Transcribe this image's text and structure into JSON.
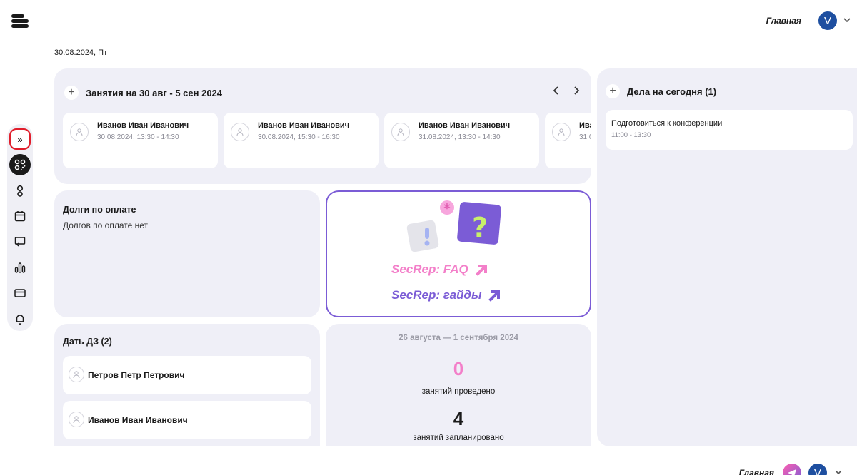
{
  "header": {
    "nav_title": "Главная",
    "avatar_letter": "V"
  },
  "date_line": "30.08.2024, Пт",
  "sidebar": {
    "expand_label": "»"
  },
  "lessons": {
    "title": "Занятия на 30 авг - 5 сен 2024",
    "cards": [
      {
        "name": "Иванов Иван Иванович",
        "time": "30.08.2024, 13:30 - 14:30"
      },
      {
        "name": "Иванов Иван Иванович",
        "time": "30.08.2024, 15:30 - 16:30"
      },
      {
        "name": "Иванов Иван Иванович",
        "time": "31.08.2024, 13:30 - 14:30"
      },
      {
        "name": "Ива",
        "time": "31.0"
      }
    ]
  },
  "today": {
    "title": "Дела на сегодня (1)",
    "items": [
      {
        "title": "Подготовиться к конференции",
        "time": "11:00 - 13:30"
      }
    ]
  },
  "debts": {
    "title": "Долги по оплате",
    "subtitle": "Долгов по оплате нет"
  },
  "faq": {
    "link1": "SecRep: FAQ",
    "link2": "SecRep: гайды"
  },
  "homework": {
    "title": "Дать ДЗ (2)",
    "items": [
      {
        "name": "Петров Петр Петрович"
      },
      {
        "name": "Иванов Иван Иванович"
      }
    ]
  },
  "stats": {
    "range": "26 августа — 1 сентября 2024",
    "done_count": "0",
    "done_label": "занятий проведено",
    "planned_count": "4",
    "planned_label": "занятий запланировано"
  },
  "footer": {
    "nav_title": "Главная",
    "avatar_letter": "V"
  },
  "colors": {
    "accent_purple": "#7b5cd6",
    "accent_pink": "#f37fc9",
    "avatar_blue": "#1e4fa0",
    "highlight_red": "#e11d2a"
  }
}
